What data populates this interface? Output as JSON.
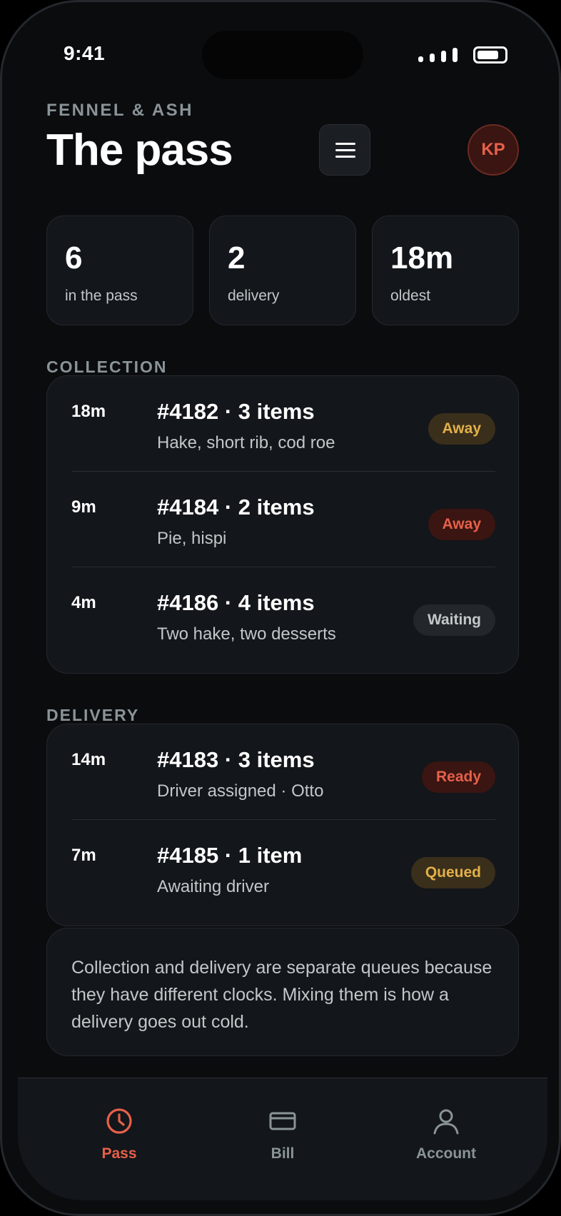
{
  "status_bar": {
    "time": "9:41",
    "battery_level": 0.8
  },
  "header": {
    "brand": "FENNEL & ASH",
    "title": "The pass",
    "menu_icon": "hamburger-icon",
    "avatar_initials": "KP"
  },
  "stats": [
    {
      "value": "6",
      "label": "in the pass"
    },
    {
      "value": "2",
      "label": "delivery"
    },
    {
      "value": "18m",
      "label": "oldest"
    }
  ],
  "collection": {
    "label": "COLLECTION",
    "orders": [
      {
        "age": "18m",
        "title": "#4182 · 3 items",
        "detail": "Hake, short rib, cod roe",
        "status": "Away"
      },
      {
        "age": "9m",
        "title": "#4184 · 2 items",
        "detail": "Pie, hispi",
        "status": "Away"
      },
      {
        "age": "4m",
        "title": "#4186 · 4 items",
        "detail": "Two hake, two desserts",
        "status": "Waiting"
      }
    ]
  },
  "delivery": {
    "label": "DELIVERY",
    "orders": [
      {
        "age": "14m",
        "title": "#4183 · 3 items",
        "detail": "Driver assigned · Otto",
        "status": "Ready"
      },
      {
        "age": "7m",
        "title": "#4185 · 1 item",
        "detail": "Awaiting driver",
        "status": "Queued"
      }
    ]
  },
  "note": "Collection and delivery are separate queues because they have different clocks. Mixing them is how a delivery goes out cold.",
  "tabs": [
    {
      "label": "Pass",
      "icon": "clock-icon",
      "active": true
    },
    {
      "label": "Bill",
      "icon": "card-icon",
      "active": false
    },
    {
      "label": "Account",
      "icon": "person-icon",
      "active": false
    }
  ],
  "colors": {
    "accent": "#e6604a",
    "amber": "#e3b04a",
    "muted": "#8a9498",
    "surface": "#13161a",
    "background": "#0b0c0e"
  }
}
